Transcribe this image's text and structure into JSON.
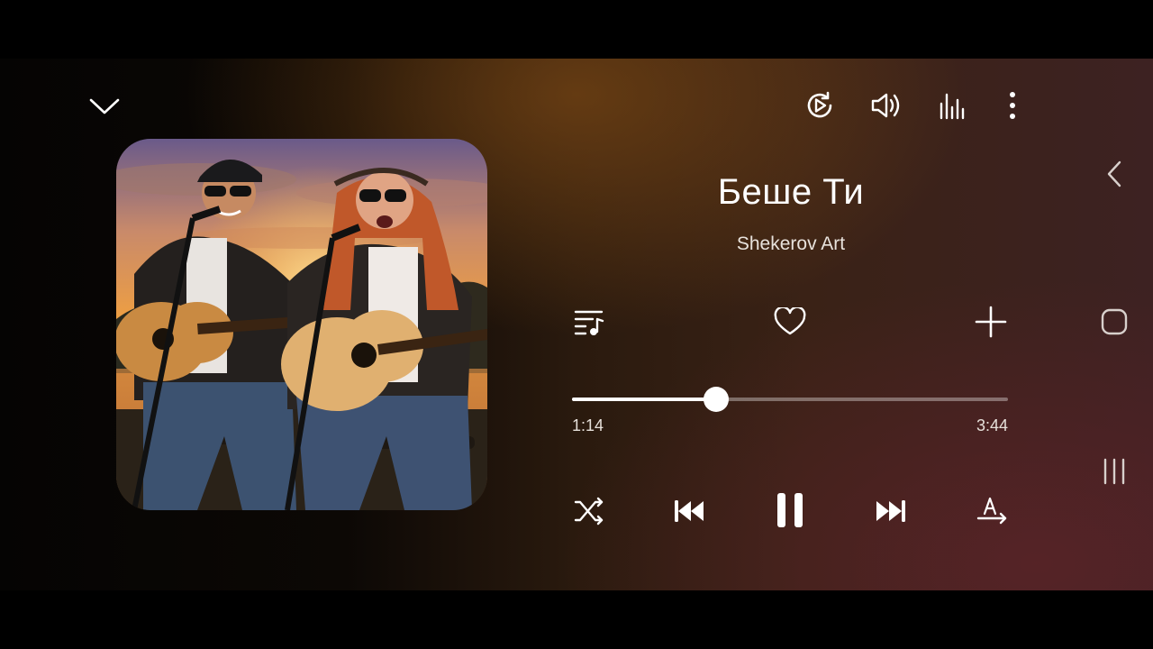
{
  "player": {
    "track_title": "Беше Ти",
    "artist": "Shekerov Art",
    "elapsed": "1:14",
    "duration": "3:44",
    "progress_fraction": 0.331,
    "is_playing": true,
    "liked": false
  },
  "top_bar": {
    "icons": [
      "chevron-down-icon",
      "playback-mode-icon",
      "volume-icon",
      "equalizer-icon",
      "more-vert-icon"
    ]
  },
  "action_row": {
    "icons": [
      "queue-music-icon",
      "heart-icon",
      "add-icon"
    ]
  },
  "controls": {
    "icons": [
      "shuffle-icon",
      "skip-previous-icon",
      "pause-icon",
      "skip-next-icon",
      "lyrics-icon"
    ]
  },
  "system_nav": {
    "icons": [
      "nav-back-icon",
      "nav-home-icon",
      "nav-recents-icon"
    ]
  },
  "colors": {
    "accent": "#ffffff",
    "track_inactive": "#8a7a70",
    "background_warm": "#3a2216",
    "background_red": "#3d2222"
  }
}
